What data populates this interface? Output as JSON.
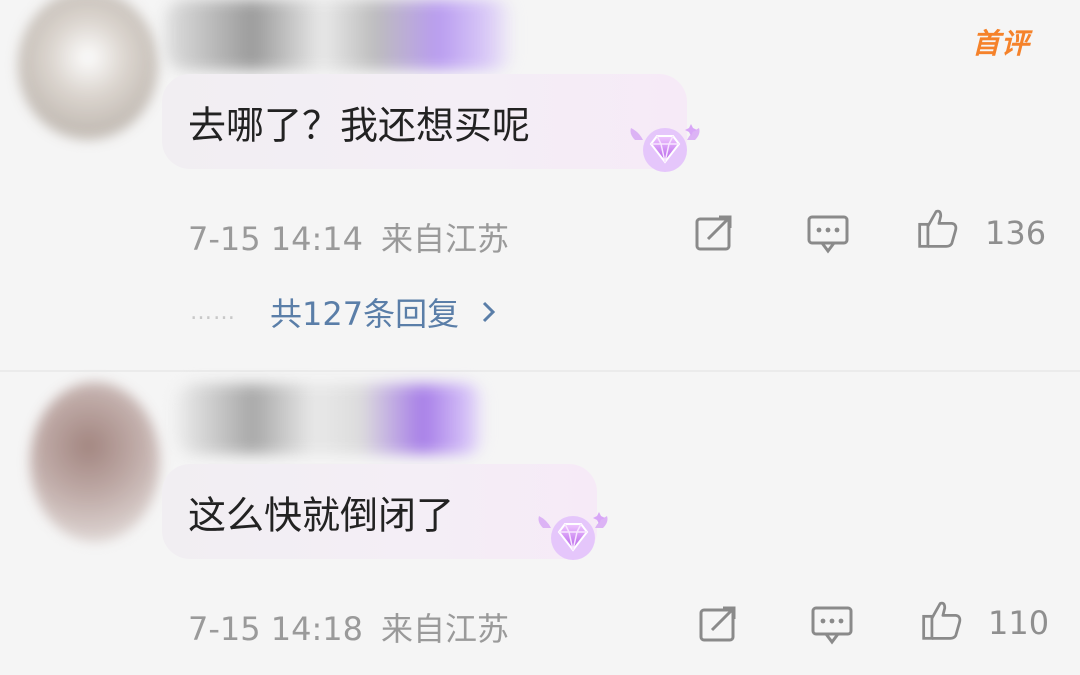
{
  "comments": [
    {
      "text": "去哪了？我还想买呢",
      "badge": "首评",
      "time": "7-15 14:14",
      "location": "来自江苏",
      "likes": "136",
      "replies_label": "共127条回复",
      "replies_dots": "……"
    },
    {
      "text": "这么快就倒闭了",
      "time": "7-15 14:18",
      "location": "来自江苏",
      "likes": "110"
    }
  ],
  "icons": {
    "share": "share-icon",
    "reply": "comment-icon",
    "like": "thumbs-up-icon",
    "gem": "diamond-badge-icon",
    "chevron": "chevron-right-icon"
  },
  "colors": {
    "accent_orange": "#f5822a",
    "link_blue": "#5a7ea8",
    "meta_gray": "#9a9a9a",
    "gem_purple": "#c36ef0"
  }
}
